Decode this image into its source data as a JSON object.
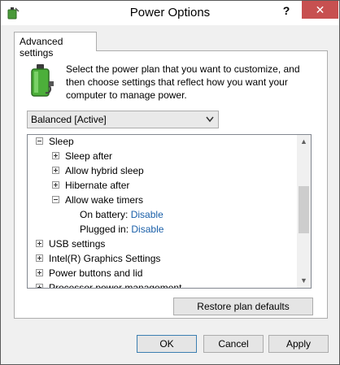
{
  "window": {
    "title": "Power Options",
    "help_label": "?",
    "close_label": "✕"
  },
  "tab": {
    "label": "Advanced settings"
  },
  "intro_text": "Select the power plan that you want to customize, and then choose settings that reflect how you want your computer to manage power.",
  "plan_select": {
    "value": "Balanced [Active]"
  },
  "tree": {
    "sleep": "Sleep",
    "sleep_after": "Sleep after",
    "allow_hybrid_sleep": "Allow hybrid sleep",
    "hibernate_after": "Hibernate after",
    "allow_wake_timers": "Allow wake timers",
    "on_battery_label": "On battery:",
    "on_battery_value": "Disable",
    "plugged_in_label": "Plugged in:",
    "plugged_in_value": "Disable",
    "usb_settings": "USB settings",
    "intel_graphics": "Intel(R) Graphics Settings",
    "power_buttons": "Power buttons and lid",
    "processor_power": "Processor power management"
  },
  "buttons": {
    "restore": "Restore plan defaults",
    "ok": "OK",
    "cancel": "Cancel",
    "apply": "Apply"
  },
  "colors": {
    "close_button": "#c75050",
    "link_value": "#1a5fa8",
    "window_bg": "#f0f0f0"
  },
  "icons": {
    "app": "power-options-icon",
    "battery": "battery-plug-icon"
  }
}
